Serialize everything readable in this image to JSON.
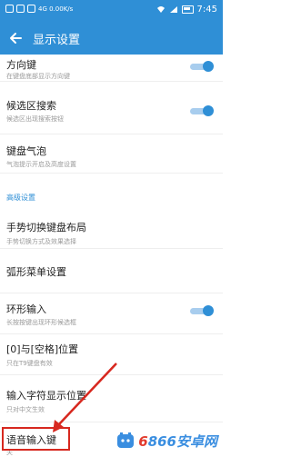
{
  "status": {
    "left": "4G 0.00K/s",
    "time": "7:45"
  },
  "header": {
    "title": "显示设置",
    "accent": "#2f8fd6"
  },
  "items": [
    {
      "title": "方向键",
      "subtitle": "在键盘底部显示方向键",
      "toggle": true
    },
    {
      "title": "候选区搜索",
      "subtitle": "候选区出现搜索按钮",
      "toggle": true
    },
    {
      "title": "键盘气泡",
      "subtitle": "气泡提示开启及高度设置",
      "toggle": false
    }
  ],
  "section": {
    "label": "高级设置"
  },
  "advanced_items": [
    {
      "title": "手势切换键盘布局",
      "subtitle": "手势切换方式及效果选择",
      "toggle": false
    },
    {
      "title": "弧形菜单设置",
      "subtitle": "",
      "toggle": false
    },
    {
      "title": "环形输入",
      "subtitle": "长按按键出现环形候选框",
      "toggle": true
    },
    {
      "title": "[0]与[空格]位置",
      "subtitle": "只在T9键盘有效",
      "toggle": false
    },
    {
      "title": "输入字符显示位置",
      "subtitle": "只对中文生效",
      "toggle": false
    },
    {
      "title": "语音输入键",
      "subtitle": "关",
      "toggle": false
    }
  ],
  "watermark": {
    "num": "6",
    "rest": "866安卓网"
  }
}
